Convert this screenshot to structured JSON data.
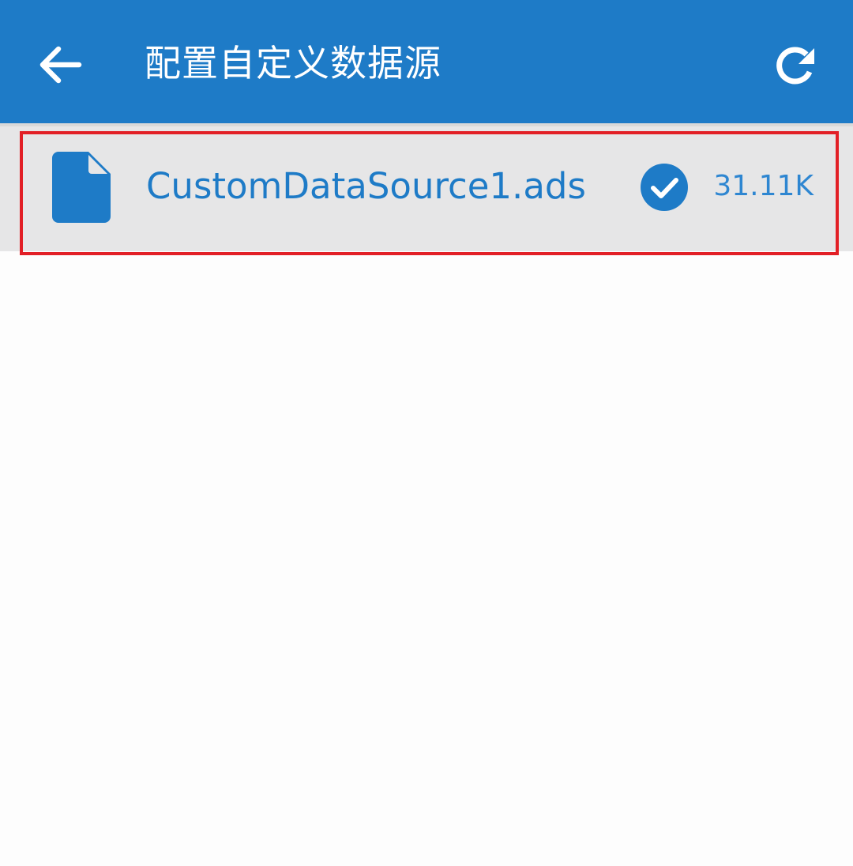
{
  "app_bar": {
    "title": "配置自定义数据源",
    "back_icon": "arrow-left-icon",
    "refresh_icon": "refresh-icon",
    "background_color": "#1e7bc7"
  },
  "file_list": {
    "items": [
      {
        "icon": "file-icon",
        "name": "CustomDataSource1.ads",
        "status_icon": "check-circle-icon",
        "size": "31.11K",
        "selected": true
      }
    ]
  },
  "colors": {
    "accent": "#1e7bc7",
    "row_background": "#e6e6e7",
    "highlight_border": "#e21f26"
  }
}
